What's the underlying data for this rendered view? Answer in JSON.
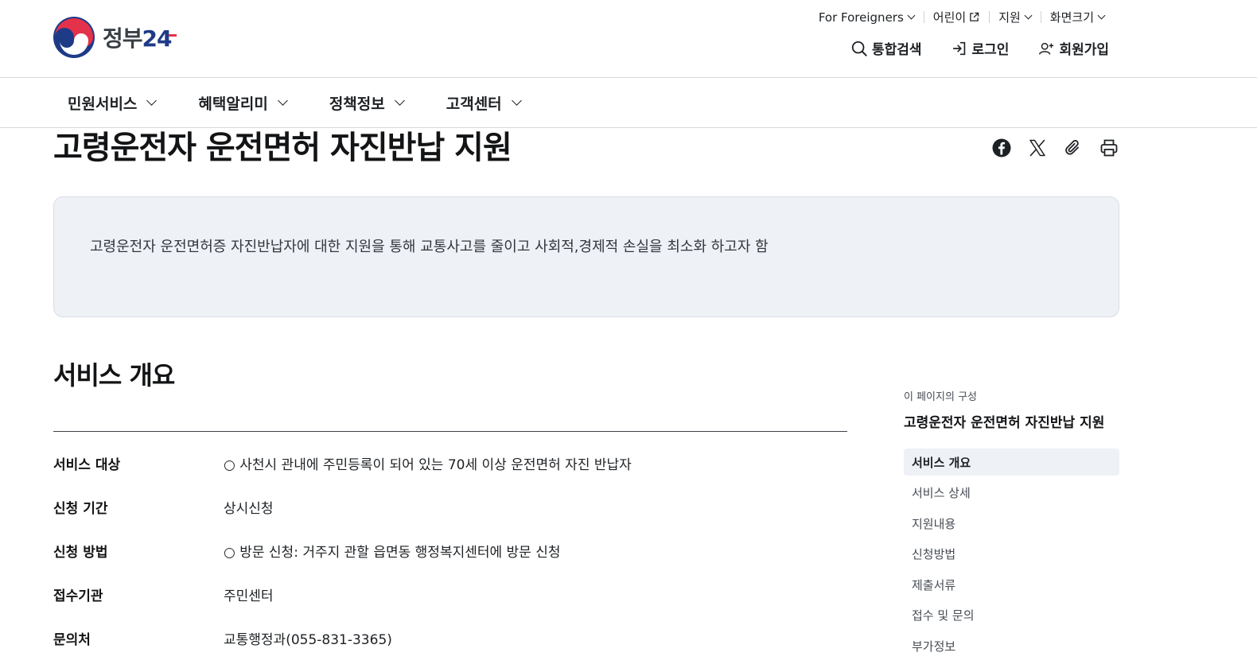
{
  "brand": {
    "logo_text_prefix": "정부",
    "logo_text_2": "2",
    "logo_text_4": "4"
  },
  "utility_nav": [
    {
      "label": "For Foreigners",
      "icon": "chevron-down-icon"
    },
    {
      "label": "어린이",
      "icon": "external-link-icon"
    },
    {
      "label": "지원",
      "icon": "chevron-down-icon"
    },
    {
      "label": "화면크기",
      "icon": "chevron-down-icon"
    }
  ],
  "header_actions": [
    {
      "label": "통합검색",
      "icon": "search-icon"
    },
    {
      "label": "로그인",
      "icon": "login-icon"
    },
    {
      "label": "회원가입",
      "icon": "user-plus-icon"
    }
  ],
  "main_nav": [
    {
      "label": "민원서비스"
    },
    {
      "label": "혜택알리미"
    },
    {
      "label": "정책정보"
    },
    {
      "label": "고객센터"
    }
  ],
  "page": {
    "title": "고령운전자 운전면허 자진반납 지원",
    "summary": "고령운전자 운전면허증 자진반납자에 대한 지원을 통해 교통사고를 줄이고 사회적,경제적 손실을 최소화 하고자 함",
    "share_icons": [
      "facebook-icon",
      "x-icon",
      "paperclip-icon",
      "print-icon"
    ]
  },
  "overview": {
    "title": "서비스 개요",
    "rows": [
      {
        "label": "서비스 대상",
        "value": "○ 사천시 관내에 주민등록이 되어 있는 70세 이상 운전면허 자진 반납자"
      },
      {
        "label": "신청 기간",
        "value": "상시신청"
      },
      {
        "label": "신청 방법",
        "value": "○ 방문 신청: 거주지 관할 읍면동 행정복지센터에 방문 신청"
      },
      {
        "label": "접수기관",
        "value": "주민센터"
      },
      {
        "label": "문의처",
        "value": "교통행정과(055-831-3365)"
      }
    ]
  },
  "toc": {
    "caption": "이 페이지의 구성",
    "title": "고령운전자 운전면허 자진반납 지원",
    "items": [
      {
        "label": "서비스 개요",
        "active": true
      },
      {
        "label": "서비스 상세",
        "active": false
      },
      {
        "label": "지원내용",
        "active": false
      },
      {
        "label": "신청방법",
        "active": false
      },
      {
        "label": "제출서류",
        "active": false
      },
      {
        "label": "접수 및 문의",
        "active": false
      },
      {
        "label": "부가정보",
        "active": false
      }
    ]
  },
  "colors": {
    "brand_blue": "#1e3b87",
    "brand_red": "#e5324b",
    "summary_bg": "#eef1f5"
  }
}
